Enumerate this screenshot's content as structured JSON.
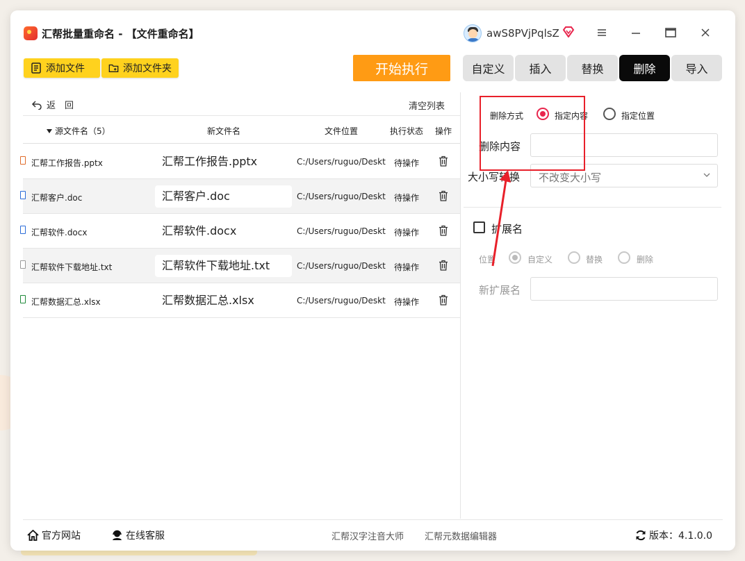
{
  "app": {
    "title": "汇帮批量重命名 - 【文件重命名】",
    "username": "awS8PVjPqlsZ"
  },
  "toolbar": {
    "add_file": "添加文件",
    "add_folder": "添加文件夹",
    "start": "开始执行"
  },
  "tabs": [
    {
      "label": "自定义",
      "active": false
    },
    {
      "label": "插入",
      "active": false
    },
    {
      "label": "替换",
      "active": false
    },
    {
      "label": "删除",
      "active": true
    },
    {
      "label": "导入",
      "active": false
    }
  ],
  "file_panel": {
    "back": "返　回",
    "clear": "清空列表",
    "columns": {
      "source": "源文件名（5）",
      "new": "新文件名",
      "location": "文件位置",
      "status": "执行状态",
      "op": "操作"
    },
    "rows": [
      {
        "src": "汇帮工作报告.pptx",
        "new": "汇帮工作报告.pptx",
        "loc": "C:/Users/ruguo/Desktop",
        "status": "待操作",
        "type": "pptx"
      },
      {
        "src": "汇帮客户.doc",
        "new": "汇帮客户.doc",
        "loc": "C:/Users/ruguo/Desktop",
        "status": "待操作",
        "type": "doc"
      },
      {
        "src": "汇帮软件.docx",
        "new": "汇帮软件.docx",
        "loc": "C:/Users/ruguo/Desktop",
        "status": "待操作",
        "type": "docx"
      },
      {
        "src": "汇帮软件下载地址.txt",
        "new": "汇帮软件下载地址.txt",
        "loc": "C:/Users/ruguo/Desktop",
        "status": "待操作",
        "type": "txt"
      },
      {
        "src": "汇帮数据汇总.xlsx",
        "new": "汇帮数据汇总.xlsx",
        "loc": "C:/Users/ruguo/Desktop",
        "status": "待操作",
        "type": "xlsx"
      }
    ]
  },
  "delete_panel": {
    "mode_label": "删除方式",
    "mode_content": "指定内容",
    "mode_position": "指定位置",
    "content_label": "删除内容",
    "content_value": "",
    "case_label": "大小写转换",
    "case_value": "不改变大小写",
    "ext_label": "扩展名",
    "pos_label": "位置",
    "pos_custom": "自定义",
    "pos_replace": "替换",
    "pos_delete": "删除",
    "new_ext_label": "新扩展名",
    "new_ext_value": ""
  },
  "footer": {
    "website": "官方网站",
    "support": "在线客服",
    "link1": "汇帮汉字注音大师",
    "link2": "汇帮元数据编辑器",
    "version": "版本：4.1.0.0"
  },
  "colors": {
    "accent_yellow": "#ffd21e",
    "start_orange": "#ff9b14",
    "radio_red": "#e8264d",
    "annotation_red": "#e8202a"
  }
}
